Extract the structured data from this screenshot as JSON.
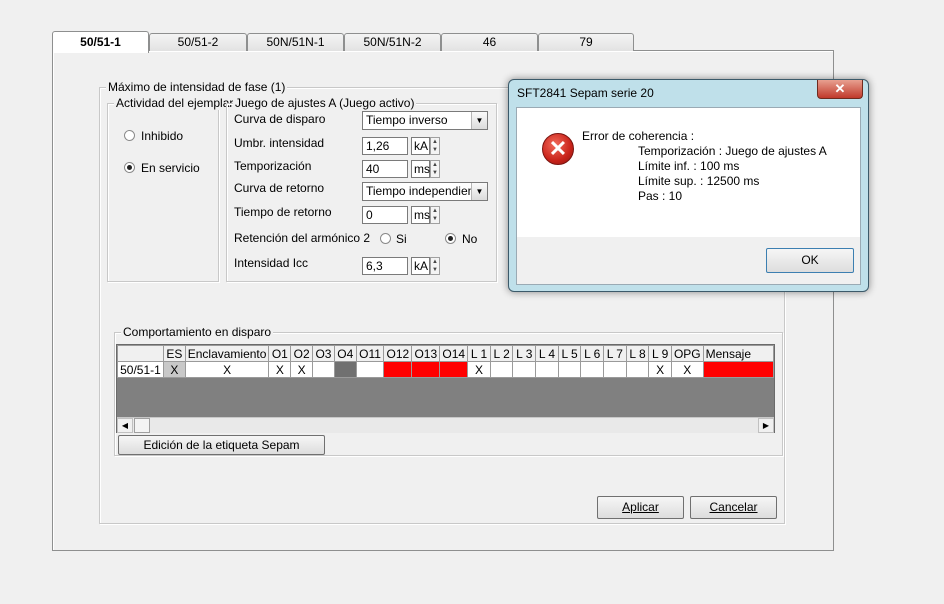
{
  "tabs": [
    "50/51-1",
    "50/51-2",
    "50N/51N-1",
    "50N/51N-2",
    "46",
    "79"
  ],
  "main_group": {
    "title": "Máximo de intensidad de fase (1)",
    "activity": {
      "title": "Actividad del ejemplar",
      "inhibido": "Inhibido",
      "en_servicio": "En servicio",
      "selected": "En servicio"
    },
    "settings": {
      "title": "Juego de ajustes A (Juego activo)",
      "curva_disparo_label": "Curva de disparo",
      "curva_disparo_value": "Tiempo inverso",
      "umbral_label": "Umbr. intensidad",
      "umbral_value": "1,26",
      "umbral_unit": "kA",
      "temporizacion_label": "Temporización",
      "temporizacion_value": "40",
      "temporizacion_unit": "ms",
      "curva_retorno_label": "Curva de retorno",
      "curva_retorno_value": "Tiempo independiente",
      "tiempo_retorno_label": "Tiempo de retorno",
      "tiempo_retorno_value": "0",
      "tiempo_retorno_unit": "ms",
      "retencion_label": "Retención del armónico 2",
      "si": "Si",
      "no": "No",
      "retencion_selected": "No",
      "icc_label": "Intensidad Icc",
      "icc_value": "6,3",
      "icc_unit": "kA"
    }
  },
  "behavior": {
    "title": "Comportamiento en disparo",
    "columns": [
      "",
      "ES",
      "Enclavamiento",
      "O1",
      "O2",
      "O3",
      "O4",
      "O11",
      "O12",
      "O13",
      "O14",
      "L 1",
      "L 2",
      "L 3",
      "L 4",
      "L 5",
      "L 6",
      "L 7",
      "L 8",
      "L 9",
      "OPG",
      "Mensaje"
    ],
    "row": [
      "50/51-1",
      "X",
      "X",
      "X",
      "X",
      "",
      "",
      "",
      "",
      "",
      "",
      "X",
      "",
      "",
      "",
      "",
      "",
      "",
      "",
      "X",
      "X",
      ""
    ],
    "edit_label_button": "Edición de la etiqueta Sepam"
  },
  "buttons": {
    "apply": "Aplicar",
    "cancel": "Cancelar"
  },
  "dialog": {
    "title": "SFT2841 Sepam serie 20",
    "close": "✕",
    "line1": "Error de coherencia :",
    "line2": "Temporización : Juego de ajustes A",
    "line3": "Límite inf. : 100 ms",
    "line4": "Límite sup. : 12500 ms",
    "line5": "Pas : 10",
    "ok": "OK"
  },
  "colors": {
    "alarm_red": "#ff0000",
    "cell_dark": "#707070",
    "grid_background": "#808080"
  }
}
